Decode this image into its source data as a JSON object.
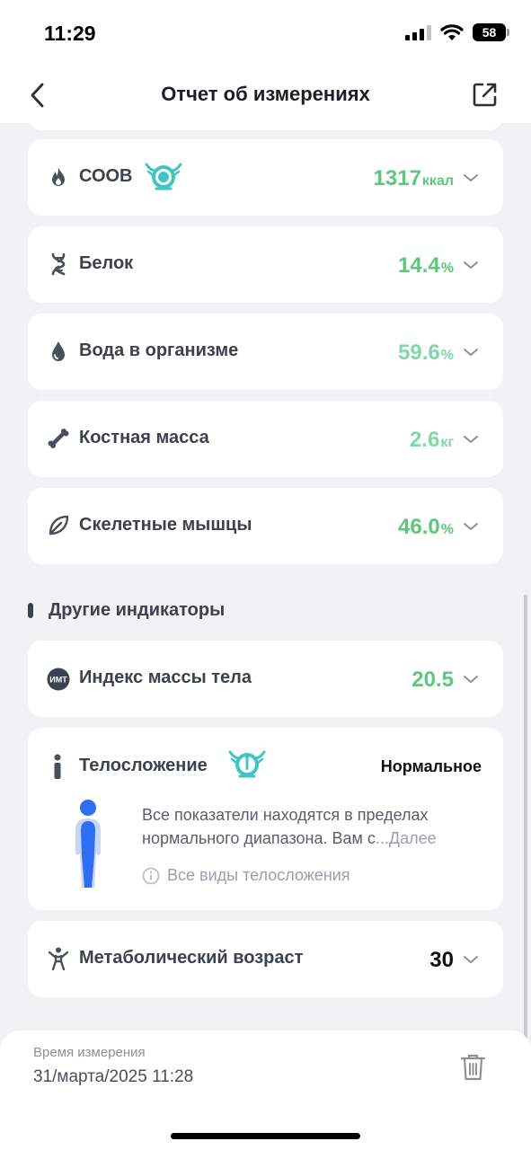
{
  "status_bar": {
    "time": "11:29",
    "battery": "58"
  },
  "nav": {
    "title": "Отчет об измерениях"
  },
  "metrics": [
    {
      "label": "СООВ",
      "value": "1317",
      "unit": "ккал",
      "icon": "flame-icon",
      "color": "#5cc97a",
      "badge": true
    },
    {
      "label": "Белок",
      "value": "14.4",
      "unit": "%",
      "icon": "dna-icon",
      "color": "#5cc97a",
      "badge": false
    },
    {
      "label": "Вода в организме",
      "value": "59.6",
      "unit": "%",
      "icon": "water-drop-icon",
      "color": "#7fd9a6",
      "badge": false
    },
    {
      "label": "Костная масса",
      "value": "2.6",
      "unit": "кг",
      "icon": "bone-icon",
      "color": "#7fd9a6",
      "badge": false
    },
    {
      "label": "Скелетные мышцы",
      "value": "46.0",
      "unit": "%",
      "icon": "leaf-icon",
      "color": "#5cc97a",
      "badge": false
    }
  ],
  "other_section": {
    "title": "Другие индикаторы"
  },
  "bmi": {
    "icon_text": "ИМТ",
    "label": "Индекс массы тела",
    "value": "20.5",
    "color": "#5cc97a"
  },
  "body_type": {
    "label": "Телосложение",
    "status": "Нормальное",
    "description": "Все показатели находятся в пределах нормального диапазона. Вам с",
    "more": "...Далее",
    "link": "Все виды телосложения"
  },
  "metabolic_age": {
    "label": "Метаболический возраст",
    "value": "30",
    "color": "#111111"
  },
  "footer": {
    "label": "Время измерения",
    "date": "31/марта/2025 11:28"
  },
  "colors": {
    "accent_green": "#5cc97a",
    "light_green": "#7fd9a6",
    "badge_teal": "#3fc6c0"
  }
}
